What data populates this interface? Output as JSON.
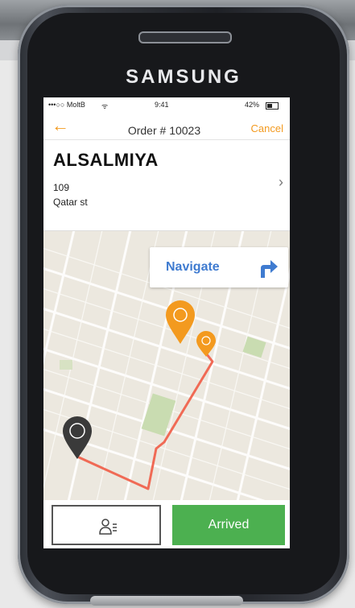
{
  "device": {
    "brand": "SAMSUNG"
  },
  "status_bar": {
    "carrier": "•••○○ MoltB",
    "wifi": "ᯤ",
    "time": "9:41",
    "battery": "42%"
  },
  "header": {
    "title": "Order # 10023",
    "cancel_label": "Cancel"
  },
  "address": {
    "area": "ALSALMIYA",
    "line1": "109",
    "line2": "Qatar st"
  },
  "map": {
    "navigate_label": "Navigate"
  },
  "actions": {
    "arrived_label": "Arrived"
  },
  "colors": {
    "accent": "#f39a1f",
    "navigate": "#3f7bd0",
    "arrived": "#4cb050",
    "route": "#f06a55"
  }
}
